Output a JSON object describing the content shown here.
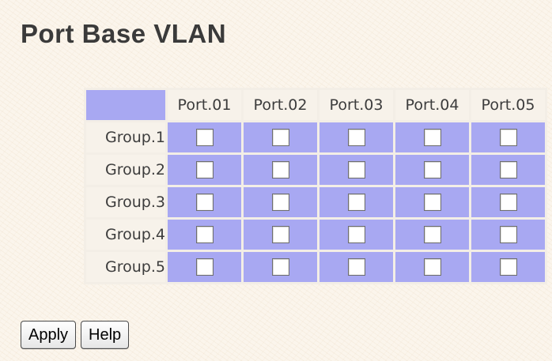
{
  "page": {
    "title": "Port Base VLAN"
  },
  "table": {
    "ports": [
      "Port.01",
      "Port.02",
      "Port.03",
      "Port.04",
      "Port.05"
    ],
    "groups": [
      {
        "label": "Group.1",
        "members": [
          false,
          false,
          false,
          false,
          false
        ]
      },
      {
        "label": "Group.2",
        "members": [
          false,
          false,
          false,
          false,
          false
        ]
      },
      {
        "label": "Group.3",
        "members": [
          false,
          false,
          false,
          false,
          false
        ]
      },
      {
        "label": "Group.4",
        "members": [
          false,
          false,
          false,
          false,
          false
        ]
      },
      {
        "label": "Group.5",
        "members": [
          false,
          false,
          false,
          false,
          false
        ]
      }
    ]
  },
  "buttons": {
    "apply_label": "Apply",
    "help_label": "Help"
  },
  "colors": {
    "table_cell": "#a8a8f2",
    "background": "#fbf5ec",
    "title_text": "#3a3a3a"
  }
}
